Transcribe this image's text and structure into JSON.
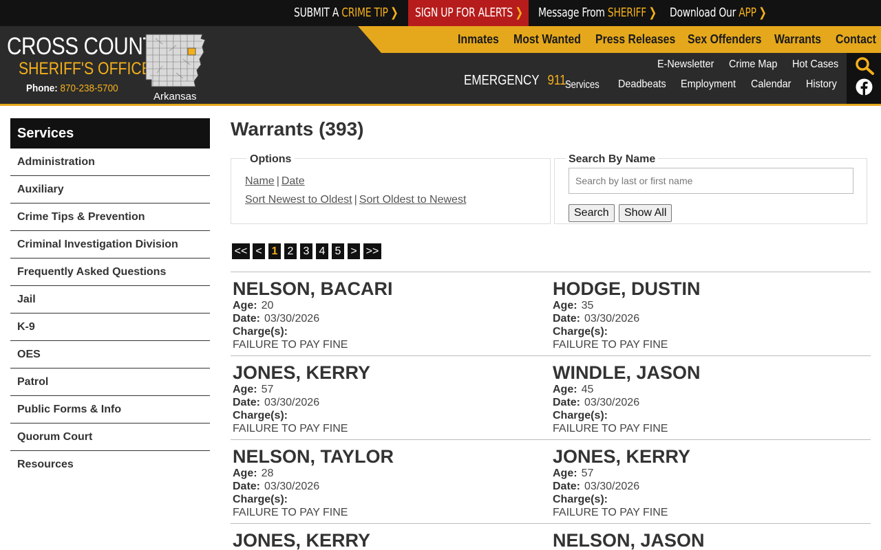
{
  "topbar": {
    "crime_tip_pre": "SUBMIT A",
    "crime_tip_hl": "CRIME TIP",
    "alerts": "SIGN UP FOR ALERTS",
    "sheriff_pre": "Message From",
    "sheriff_hl": "SHERIFF",
    "app_pre": "Download Our",
    "app_hl": "APP",
    "chevron": "❯"
  },
  "logo": {
    "name": "CROSS COUNTY",
    "sub": "SHERIFF'S OFFICE",
    "phone_label": "Phone:",
    "phone_number": "870-238-5700",
    "state": "Arkansas"
  },
  "main_nav": [
    "Inmates",
    "Most Wanted",
    "Press Releases",
    "Sex Offenders",
    "Warrants",
    "Contact"
  ],
  "emergency": {
    "label": "EMERGENCY",
    "number": "911"
  },
  "sub_nav": {
    "row1": [
      "E-Newsletter",
      "Crime Map",
      "Hot Cases"
    ],
    "services": "Services",
    "row2": [
      "Deadbeats",
      "Employment",
      "Calendar",
      "History"
    ]
  },
  "sidebar": {
    "title": "Services",
    "items": [
      "Administration",
      "Auxiliary",
      "Crime Tips & Prevention",
      "Criminal Investigation Division",
      "Frequently Asked Questions",
      "Jail",
      "K-9",
      "OES",
      "Patrol",
      "Public Forms & Info",
      "Quorum Court",
      "Resources"
    ]
  },
  "page": {
    "title": "Warrants (393)"
  },
  "options": {
    "legend": "Options",
    "name": "Name",
    "date": "Date",
    "sep": "|",
    "newest": "Sort Newest to Oldest",
    "oldest": "Sort Oldest to Newest"
  },
  "search": {
    "legend": "Search By Name",
    "placeholder": "Search by last or first name",
    "search_btn": "Search",
    "show_all_btn": "Show All"
  },
  "pager": [
    "<<",
    "<",
    "1",
    "2",
    "3",
    "4",
    "5",
    ">",
    ">>"
  ],
  "labels": {
    "age": "Age:",
    "date": "Date:",
    "charges": "Charge(s):"
  },
  "warrants": [
    {
      "name": "NELSON, BACARI",
      "age": "20",
      "date": "03/30/2026",
      "charge": "FAILURE TO PAY FINE"
    },
    {
      "name": "HODGE, DUSTIN",
      "age": "35",
      "date": "03/30/2026",
      "charge": "FAILURE TO PAY FINE"
    },
    {
      "name": "JONES, KERRY",
      "age": "57",
      "date": "03/30/2026",
      "charge": "FAILURE TO PAY FINE"
    },
    {
      "name": "WINDLE, JASON",
      "age": "45",
      "date": "03/30/2026",
      "charge": "FAILURE TO PAY FINE"
    },
    {
      "name": "NELSON, TAYLOR",
      "age": "28",
      "date": "03/30/2026",
      "charge": "FAILURE TO PAY FINE"
    },
    {
      "name": "JONES, KERRY",
      "age": "57",
      "date": "03/30/2026",
      "charge": "FAILURE TO PAY FINE"
    },
    {
      "name": "JONES, KERRY",
      "age": "",
      "date": "",
      "charge": ""
    },
    {
      "name": "NELSON, JASON",
      "age": "",
      "date": "",
      "charge": ""
    }
  ],
  "colors": {
    "accent": "#e5a81c",
    "alert_red": "#b71c1c",
    "header_bg": "#2b2b2b",
    "topbar_bg": "#121212"
  }
}
